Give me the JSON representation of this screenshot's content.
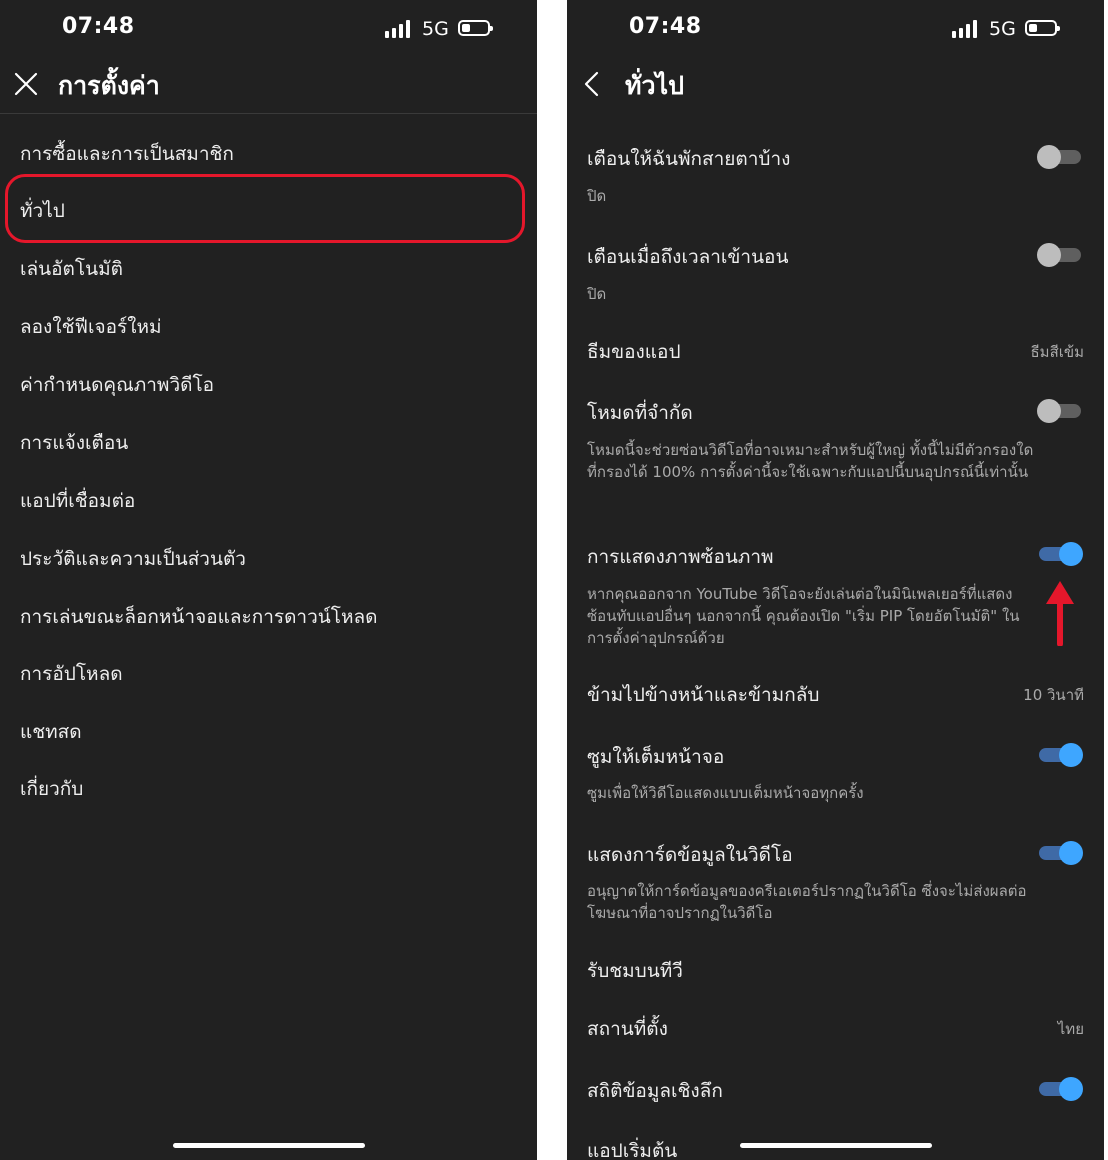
{
  "colors": {
    "background": "#212121",
    "text_primary": "#eeeeee",
    "text_secondary": "#aaaaaa",
    "toggle_on": "#3ea6ff",
    "highlight": "#e5172b"
  },
  "left_screen": {
    "status": {
      "time": "07:48",
      "network": "5G"
    },
    "header": {
      "title": "การตั้งค่า",
      "close_icon": "close-icon"
    },
    "items": [
      {
        "label": "การซื้อและการเป็นสมาชิก"
      },
      {
        "label": "ทั่วไป",
        "highlighted": true
      },
      {
        "label": "เล่นอัตโนมัติ"
      },
      {
        "label": "ลองใช้ฟีเจอร์ใหม่"
      },
      {
        "label": "ค่ากำหนดคุณภาพวิดีโอ"
      },
      {
        "label": "การแจ้งเตือน"
      },
      {
        "label": "แอปที่เชื่อมต่อ"
      },
      {
        "label": "ประวัติและความเป็นส่วนตัว"
      },
      {
        "label": "การเล่นขณะล็อกหน้าจอและการดาวน์โหลด"
      },
      {
        "label": "การอัปโหลด"
      },
      {
        "label": "แชทสด"
      },
      {
        "label": "เกี่ยวกับ"
      }
    ]
  },
  "right_screen": {
    "status": {
      "time": "07:48",
      "network": "5G"
    },
    "header": {
      "title": "ทั่วไป",
      "back_icon": "chevron-left-icon"
    },
    "settings": [
      {
        "title": "เตือนให้ฉันพักสายตาบ้าง",
        "subtitle": "ปิด",
        "toggle": "off"
      },
      {
        "title": "เตือนเมื่อถึงเวลาเข้านอน",
        "subtitle": "ปิด",
        "toggle": "off"
      },
      {
        "title": "ธีมของแอป",
        "value": "ธีมสีเข้ม"
      },
      {
        "title": "โหมดที่จำกัด",
        "description": "โหมดนี้จะช่วยซ่อนวิดีโอที่อาจเหมาะสำหรับผู้ใหญ่ ทั้งนี้ไม่มีตัวกรองใดที่กรองได้ 100% การตั้งค่านี้จะใช้เฉพาะกับแอปนี้บนอุปกรณ์นี้เท่านั้น",
        "toggle": "off"
      },
      {
        "title": "การแสดงภาพซ้อนภาพ",
        "description": "หากคุณออกจาก YouTube วิดีโอจะยังเล่นต่อในมินิเพลเยอร์ที่แสดงซ้อนทับแอปอื่นๆ นอกจากนี้ คุณต้องเปิด \"เริ่ม PIP โดยอัตโนมัติ\" ในการตั้งค่าอุปกรณ์ด้วย",
        "toggle": "on"
      },
      {
        "title": "ข้ามไปข้างหน้าและข้ามกลับ",
        "value": "10 วินาที"
      },
      {
        "title": "ซูมให้เต็มหน้าจอ",
        "description": "ซูมเพื่อให้วิดีโอแสดงแบบเต็มหน้าจอทุกครั้ง",
        "toggle": "on"
      },
      {
        "title": "แสดงการ์ดข้อมูลในวิดีโอ",
        "description": "อนุญาตให้การ์ดข้อมูลของครีเอเตอร์ปรากฏในวิดีโอ ซึ่งจะไม่ส่งผลต่อโฆษณาที่อาจปรากฏในวิดีโอ",
        "toggle": "on"
      },
      {
        "title": "รับชมบนทีวี"
      },
      {
        "title": "สถานที่ตั้ง",
        "value": "ไทย"
      },
      {
        "title": "สถิติข้อมูลเชิงลึก",
        "toggle": "on"
      },
      {
        "title": "แอปเริ่มต้น"
      }
    ]
  },
  "icons": [
    "close-icon",
    "chevron-left-icon",
    "signal-icon",
    "battery-icon",
    "red-arrow-up-icon"
  ]
}
